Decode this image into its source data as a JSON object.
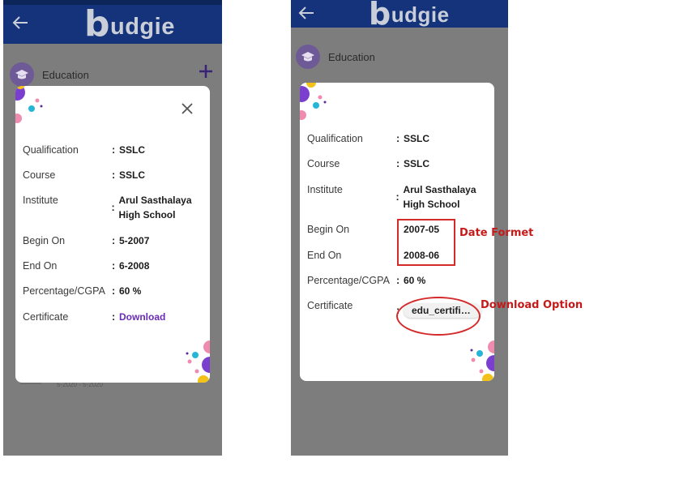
{
  "app": {
    "logo_letter": "b",
    "logo_text": "udgie",
    "section_title": "Education"
  },
  "left_dialog": {
    "rows": [
      {
        "label": "Qualification",
        "value": "SSLC"
      },
      {
        "label": "Course",
        "value": "SSLC"
      },
      {
        "label": "Institute",
        "value": "Arul Sasthalaya High School"
      },
      {
        "label": "Begin On",
        "value": "5-2007"
      },
      {
        "label": "End On",
        "value": "6-2008"
      },
      {
        "label": "Percentage/CGPA",
        "value": "60 %"
      },
      {
        "label": "Certificate",
        "value": "Download"
      }
    ],
    "behind_date": "5-2020 - 5-2020"
  },
  "right_dialog": {
    "rows": [
      {
        "label": "Qualification",
        "value": "SSLC"
      },
      {
        "label": "Course",
        "value": "SSLC"
      },
      {
        "label": "Institute",
        "value": "Arul Sasthalaya High School"
      },
      {
        "label": "Begin On",
        "value": "2007-05"
      },
      {
        "label": "End On",
        "value": "2008-06"
      },
      {
        "label": "Percentage/CGPA",
        "value": "60 %"
      },
      {
        "label": "Certificate",
        "value": "edu_certific..."
      }
    ]
  },
  "annotations": {
    "date_format": "Date Formet",
    "download_option": "Download Option"
  },
  "colors": {
    "header": "#14337a",
    "link": "#6a2bb5",
    "annotation": "#d42a2a"
  },
  "icons": [
    "back-arrow-icon",
    "graduation-cap-icon",
    "plus-icon",
    "close-icon"
  ]
}
